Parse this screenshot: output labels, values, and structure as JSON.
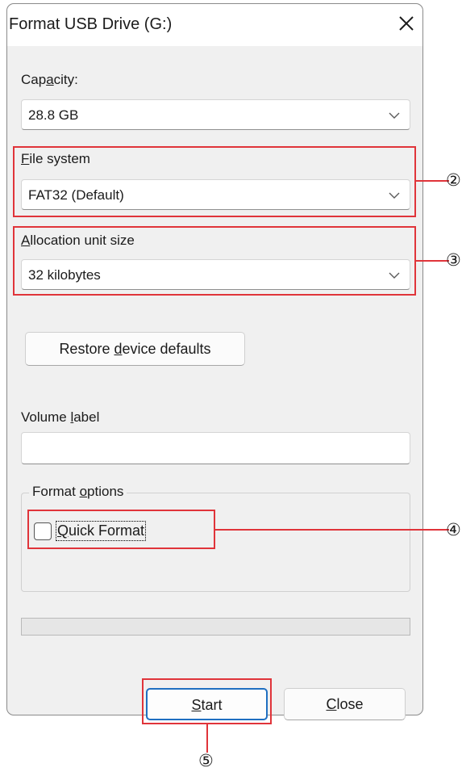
{
  "dialog": {
    "title": "Format USB Drive (G:)",
    "close_glyph": "✕"
  },
  "capacity": {
    "label_pre": "Cap",
    "label_key": "a",
    "label_post": "city:",
    "value": "28.8 GB"
  },
  "file_system": {
    "label_pre": "",
    "label_key": "F",
    "label_post": "ile system",
    "value": "FAT32 (Default)"
  },
  "allocation": {
    "label_pre": "",
    "label_key": "A",
    "label_post": "llocation unit size",
    "value": "32 kilobytes"
  },
  "restore_button": {
    "label_pre": "Restore ",
    "label_key": "d",
    "label_post": "evice defaults"
  },
  "volume_label": {
    "label_pre": "Volume ",
    "label_key": "l",
    "label_post": "abel",
    "value": ""
  },
  "format_options": {
    "title_pre": "Format ",
    "title_key": "o",
    "title_post": "ptions",
    "quick_format": {
      "checked": false,
      "label_pre": "",
      "label_key": "Q",
      "label_post": "uick Format"
    }
  },
  "progress": {
    "fraction": 0
  },
  "start_button": {
    "label_pre": "",
    "label_key": "S",
    "label_post": "tart"
  },
  "close_button": {
    "label_pre": "",
    "label_key": "C",
    "label_post": "lose"
  },
  "callouts": {
    "color": "#e0343a",
    "file_system_marker": "②",
    "allocation_marker": "③",
    "quick_format_marker": "④",
    "start_marker": "⑤"
  },
  "icons": {
    "close": "close-icon",
    "dropdown": "chevron-down-icon"
  }
}
